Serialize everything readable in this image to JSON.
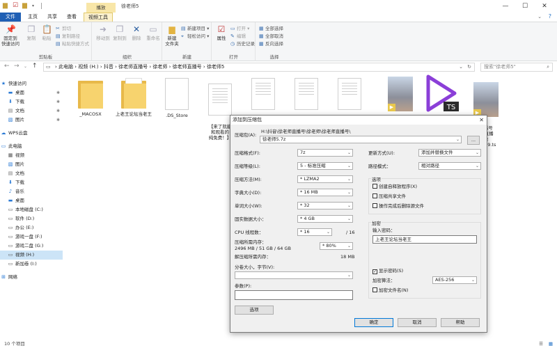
{
  "window": {
    "title": "徐老师5",
    "context_tab_label": "播放",
    "minimize": "—",
    "maximize": "☐",
    "close": "✕"
  },
  "tabs": [
    "文件",
    "主页",
    "共享",
    "查看",
    "视频工具"
  ],
  "ribbon": {
    "clipboard": {
      "label": "剪贴板",
      "pin": "固定到\n快速访问",
      "copy": "复制",
      "paste": "粘贴",
      "cut": "剪切",
      "copy_path": "复制路径",
      "paste_shortcut": "粘贴快捷方式"
    },
    "organize": {
      "label": "组织",
      "move_to": "移动到",
      "copy_to": "复制到",
      "delete": "删除",
      "rename": "重命名"
    },
    "new": {
      "label": "新建",
      "new_folder": "新建\n文件夹",
      "new_item": "新建项目",
      "easy_access": "轻松访问"
    },
    "open": {
      "label": "打开",
      "properties": "属性",
      "open": "打开",
      "edit": "编辑",
      "history": "历史记录"
    },
    "select": {
      "label": "选择",
      "select_all": "全部选择",
      "select_none": "全部取消",
      "invert": "反向选择"
    }
  },
  "address": {
    "path": [
      "此电脑",
      "视频 (H:)",
      "抖音",
      "徐老师直播号",
      "徐老师",
      "徐老师直播号",
      "徐老师5"
    ],
    "search_placeholder": "搜索\"徐老师5\""
  },
  "nav": {
    "quick_access": "快速访问",
    "items": [
      "桌面",
      "下载",
      "文档",
      "图片"
    ],
    "wps": "WPS云盘",
    "this_pc": "此电脑",
    "pc_items": [
      "视频",
      "图片",
      "文档",
      "下载",
      "音乐",
      "桌面",
      "本地磁盘 (C:)",
      "软件 (D:)",
      "办公 (E:)",
      "游戏一盘 (F:)",
      "游戏二盘 (G:)",
      "视频 (H:)",
      "新加卷 (I:)"
    ],
    "network": "网络"
  },
  "files": [
    {
      "name": "_MACOSX"
    },
    {
      "name": "上老王论坛当老王"
    },
    {
      "name": ".DS_Store"
    },
    {
      "name": "【来了就能\n和观看的\n纯免费！】"
    },
    {
      "name": ""
    },
    {
      "name": ""
    },
    {
      "name": ""
    },
    {
      "name": ""
    },
    {
      "name": ""
    },
    {
      "name": "直播号\n19直播\n像\n56639.ts"
    }
  ],
  "status": {
    "count": "10 个项目"
  },
  "dialog": {
    "title": "添加到压缩包",
    "close": "✕",
    "archive_label": "压缩包(A):",
    "archive_path": "H:\\抖音\\徐老师直播号\\徐老师\\徐老师直播号\\",
    "archive_name": "徐老师5.7z",
    "browse": "...",
    "format_label": "压缩格式(F):",
    "format": "7z",
    "level_label": "压缩等级(L):",
    "level": "5 - 标准压缩",
    "method_label": "压缩方法(M):",
    "method": "* LZMA2",
    "dict_label": "字典大小(D):",
    "dict": "* 16 MB",
    "word_label": "单词大小(W):",
    "word": "* 32",
    "solid_label": "固实数据大小：",
    "solid": "* 4 GB",
    "threads_label": "CPU 线程数：",
    "threads": "* 16",
    "threads_max": "/ 16",
    "mem_label": "压缩所需内存：",
    "mem_detail": "2496 MB / 51 GB / 64 GB",
    "mem_pct": "* 80%",
    "decomp_label": "解压缩所需内存：",
    "decomp": "18 MB",
    "split_label": "分卷大小，字节(V):",
    "params_label": "参数(P):",
    "options_btn": "选项",
    "update_label": "更新方式(U):",
    "update": "添加并替换文件",
    "pathmode_label": "路径模式：",
    "pathmode": "相对路径",
    "opts_title": "选项",
    "opt_sfx": "创建自释放程序(X)",
    "opt_shared": "压缩共享文件",
    "opt_delete": "操作完成后删除源文件",
    "enc_title": "加密",
    "pwd_label": "输入密码：",
    "pwd": "上老王论坛当老王",
    "show_pwd": "显示密码(S)",
    "enc_method_label": "加密算法：",
    "enc_method": "AES-256",
    "enc_names": "加密文件名(N)",
    "ok": "确定",
    "cancel": "取消",
    "help": "帮助"
  }
}
